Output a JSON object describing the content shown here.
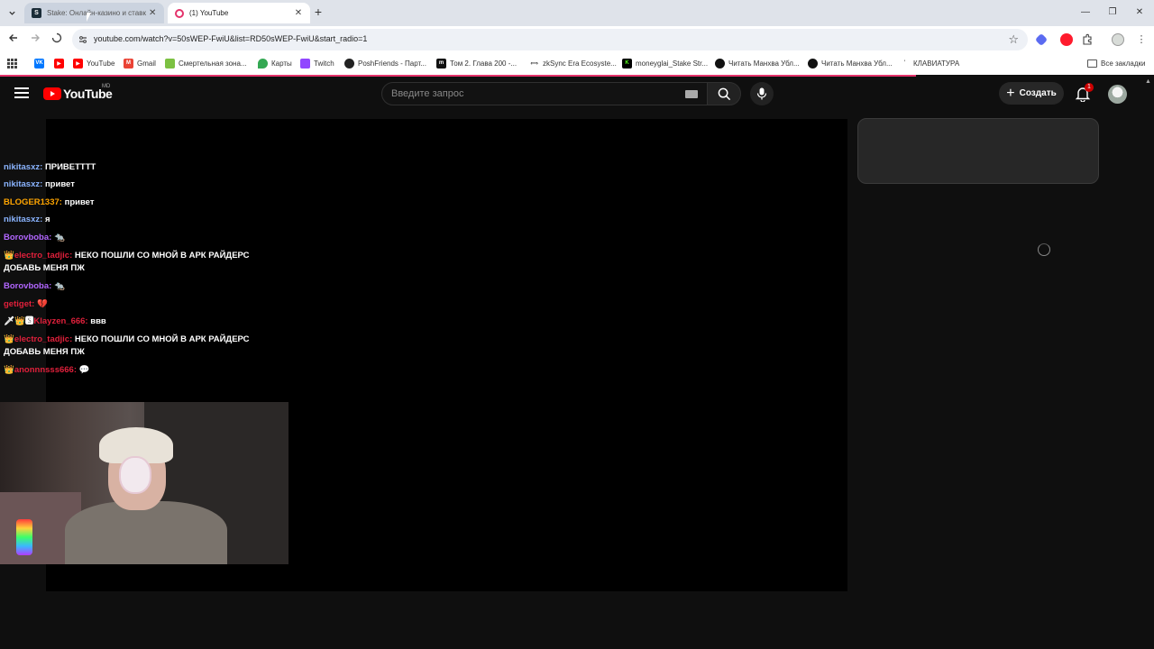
{
  "browser": {
    "tabs": [
      {
        "label": "Stake: Онлайн-казино и ставки",
        "active": false
      },
      {
        "label": "(1) YouTube",
        "active": true
      }
    ],
    "url": "youtube.com/watch?v=50sWEP-FwiU&list=RD50sWEP-FwiU&start_radio=1",
    "bookmarks": [
      {
        "label": "",
        "icon": "vk-icon",
        "color": "#0077ff"
      },
      {
        "label": "",
        "icon": "youtube-icon",
        "color": "#ff0000"
      },
      {
        "label": "YouTube",
        "icon": "youtube-icon",
        "color": "#ff0000"
      },
      {
        "label": "Gmail",
        "icon": "gmail-icon",
        "color": "#ea4335"
      },
      {
        "label": "Смертельная зона...",
        "icon": "green-icon",
        "color": "#7cc142"
      },
      {
        "label": "Карты",
        "icon": "maps-icon",
        "color": "#34a853"
      },
      {
        "label": "Twitch",
        "icon": "twitch-icon",
        "color": "#9146ff"
      },
      {
        "label": "PoshFriends - Парт...",
        "icon": "posh-icon",
        "color": "#222222"
      },
      {
        "label": "Том 2. Глава 200 -...",
        "icon": "manga-icon",
        "color": "#111111"
      },
      {
        "label": "zkSync Era Ecosyste...",
        "icon": "zksync-icon",
        "color": "#333333"
      },
      {
        "label": "moneyglai_Stake Str...",
        "icon": "kick-icon",
        "color": "#53fc18"
      },
      {
        "label": "Читать Манхва Убл...",
        "icon": "manhwa-icon",
        "color": "#111111"
      },
      {
        "label": "Читать Манхва Убл...",
        "icon": "manhwa-icon",
        "color": "#111111"
      },
      {
        "label": "КЛАВИАТУРА",
        "icon": "dot-icon",
        "color": "#666666"
      }
    ],
    "all_bookmarks": "Все закладки"
  },
  "youtube": {
    "logo_text": "YouTube",
    "region": "MD",
    "search_placeholder": "Введите запрос",
    "create_label": "Создать",
    "notification_count": "1"
  },
  "chat": [
    {
      "user": "nikitasxz:",
      "text": "ПРИВЕТТТТ",
      "color": "#8ab4ff",
      "badges": ""
    },
    {
      "user": "nikitasxz:",
      "text": "привет",
      "color": "#8ab4ff",
      "badges": ""
    },
    {
      "user": "BLOGER1337:",
      "text": "привет",
      "color": "#ffa500",
      "badges": ""
    },
    {
      "user": "nikitasxz:",
      "text": "я",
      "color": "#8ab4ff",
      "badges": ""
    },
    {
      "user": "Borovboba:",
      "text": "🐀",
      "color": "#b266ff",
      "badges": ""
    },
    {
      "user": "electro_tadjic:",
      "text": "НЕКО ПОШЛИ СО МНОЙ В АРК РАЙДЕРС ДОБАВЬ МЕНЯ ПЖ",
      "color": "#e0203b",
      "badges": "👑"
    },
    {
      "user": "Borovboba:",
      "text": "🐀",
      "color": "#b266ff",
      "badges": ""
    },
    {
      "user": "getiget:",
      "text": "💔",
      "color": "#e0203b",
      "badges": ""
    },
    {
      "user": "Klayzen_666:",
      "text": "ввв",
      "color": "#e0203b",
      "badges": "🗡👑🆂"
    },
    {
      "user": "electro_tadjic:",
      "text": "НЕКО ПОШЛИ СО МНОЙ В АРК РАЙДЕРС ДОБАВЬ МЕНЯ ПЖ",
      "color": "#e0203b",
      "badges": "👑"
    },
    {
      "user": "anonnnsss666:",
      "text": "💬",
      "color": "#e0203b",
      "badges": "👑"
    }
  ]
}
